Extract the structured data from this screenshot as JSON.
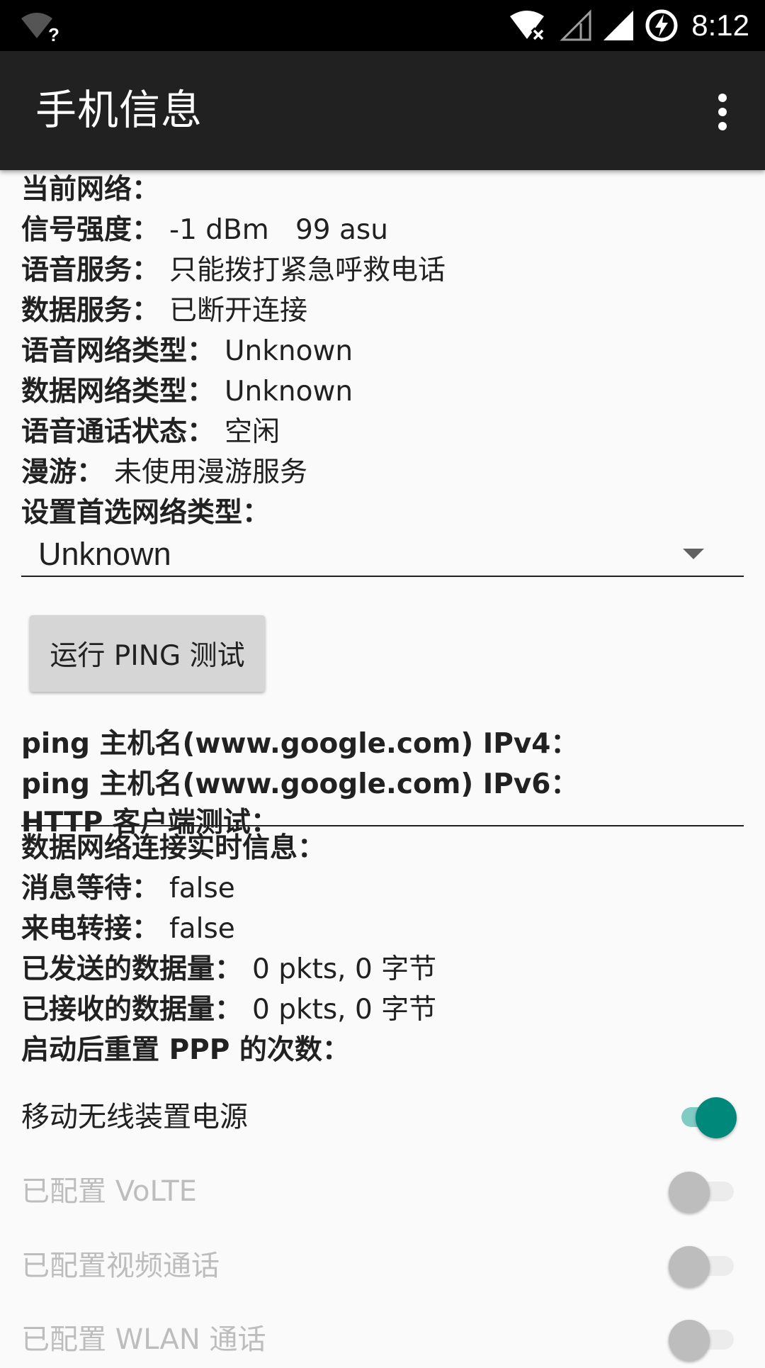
{
  "status_bar": {
    "time": "8:12",
    "icons": [
      "wifi-unknown-icon",
      "wifi-no-internet-icon",
      "cellular-empty-icon",
      "cellular-full-icon",
      "battery-charging-icon"
    ]
  },
  "app_bar": {
    "title": "手机信息",
    "overflow_icon": "more-vert-icon"
  },
  "info": {
    "current_network": {
      "label": "当前网络：",
      "value": ""
    },
    "signal_strength": {
      "label": "信号强度：",
      "value": "-1 dBm   99 asu"
    },
    "voice_service": {
      "label": "语音服务：",
      "value": "只能拨打紧急呼救电话"
    },
    "data_service": {
      "label": "数据服务：",
      "value": "已断开连接"
    },
    "voice_network_type": {
      "label": "语音网络类型：",
      "value": "Unknown"
    },
    "data_network_type": {
      "label": "数据网络类型：",
      "value": "Unknown"
    },
    "voice_call_status": {
      "label": "语音通话状态：",
      "value": "空闲"
    },
    "roaming": {
      "label": "漫游：",
      "value": "未使用漫游服务"
    },
    "preferred_network_label": "设置首选网络类型："
  },
  "preferred_network": {
    "selected": "Unknown"
  },
  "ping": {
    "button_label": "运行 PING 测试",
    "ipv4_label": "ping 主机名(www.google.com) IPv4：",
    "ipv6_label": "ping 主机名(www.google.com) IPv6：",
    "http_label": "HTTP 客户端测试："
  },
  "data_conn": {
    "title": "数据网络连接实时信息：",
    "message_waiting": {
      "label": "消息等待：",
      "value": "false"
    },
    "call_forwarding": {
      "label": "来电转接：",
      "value": "false"
    },
    "sent": {
      "label": "已发送的数据量：",
      "value": "0 pkts, 0 字节"
    },
    "received": {
      "label": "已接收的数据量：",
      "value": "0 pkts, 0 字节"
    },
    "ppp_reset": {
      "label": "启动后重置 PPP 的次数：",
      "value": ""
    }
  },
  "toggles": [
    {
      "label": "移动无线装置电源",
      "checked": true,
      "enabled": true
    },
    {
      "label": "已配置 VoLTE",
      "checked": false,
      "enabled": false
    },
    {
      "label": "已配置视频通话",
      "checked": false,
      "enabled": false
    },
    {
      "label": "已配置 WLAN 通话",
      "checked": false,
      "enabled": false
    }
  ],
  "colors": {
    "accent": "#00897b",
    "accent_track": "#80cbc4",
    "app_bar": "#212121",
    "status_bar": "#000000",
    "background": "#fafafa",
    "disabled_text": "#bdbdbd"
  }
}
